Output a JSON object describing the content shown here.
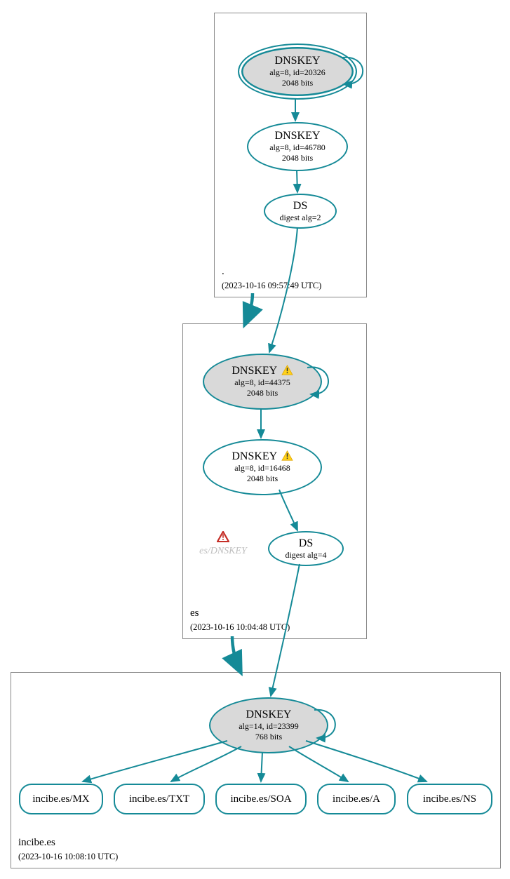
{
  "zones": {
    "root": {
      "label": ".",
      "timestamp": "(2023-10-16 09:57:49 UTC)"
    },
    "es": {
      "label": "es",
      "timestamp": "(2023-10-16 10:04:48 UTC)"
    },
    "incibe": {
      "label": "incibe.es",
      "timestamp": "(2023-10-16 10:08:10 UTC)"
    }
  },
  "nodes": {
    "root_ksk": {
      "title": "DNSKEY",
      "alg": "alg=8, id=20326",
      "bits": "2048 bits"
    },
    "root_zsk": {
      "title": "DNSKEY",
      "alg": "alg=8, id=46780",
      "bits": "2048 bits"
    },
    "root_ds": {
      "title": "DS",
      "alg": "digest alg=2"
    },
    "es_ksk": {
      "title": "DNSKEY",
      "alg": "alg=8, id=44375",
      "bits": "2048 bits",
      "warn": true
    },
    "es_zsk": {
      "title": "DNSKEY",
      "alg": "alg=8, id=16468",
      "bits": "2048 bits",
      "warn": true
    },
    "es_ds": {
      "title": "DS",
      "alg": "digest alg=4"
    },
    "incibe_key": {
      "title": "DNSKEY",
      "alg": "alg=14, id=23399",
      "bits": "768 bits"
    }
  },
  "error": {
    "label": "es/DNSKEY"
  },
  "rr": {
    "mx": "incibe.es/MX",
    "txt": "incibe.es/TXT",
    "soa": "incibe.es/SOA",
    "a": "incibe.es/A",
    "ns": "incibe.es/NS"
  }
}
